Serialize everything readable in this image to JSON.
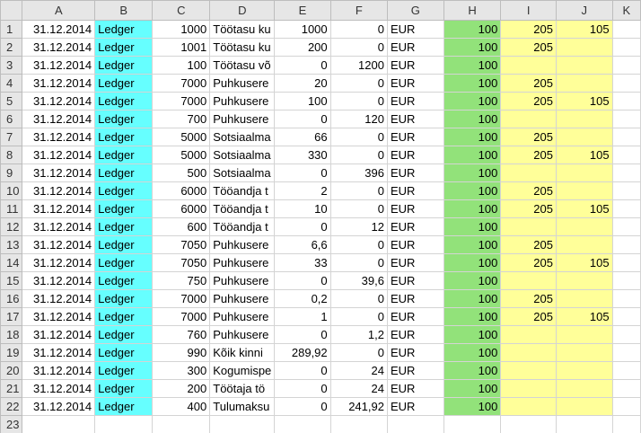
{
  "columns": [
    "A",
    "B",
    "C",
    "D",
    "E",
    "F",
    "G",
    "H",
    "I",
    "J",
    "K"
  ],
  "rows": [
    {
      "n": "1",
      "a": "31.12.2014",
      "b": "Ledger",
      "c": "1000",
      "d": "Töötasu ku",
      "e": "1000",
      "f": "0",
      "g": "EUR",
      "h": "100",
      "i": "205",
      "j": "105"
    },
    {
      "n": "2",
      "a": "31.12.2014",
      "b": "Ledger",
      "c": "1001",
      "d": "Töötasu ku",
      "e": "200",
      "f": "0",
      "g": "EUR",
      "h": "100",
      "i": "205",
      "j": ""
    },
    {
      "n": "3",
      "a": "31.12.2014",
      "b": "Ledger",
      "c": "100",
      "d": "Töötasu võ",
      "e": "0",
      "f": "1200",
      "g": "EUR",
      "h": "100",
      "i": "",
      "j": ""
    },
    {
      "n": "4",
      "a": "31.12.2014",
      "b": "Ledger",
      "c": "7000",
      "d": "Puhkusere",
      "e": "20",
      "f": "0",
      "g": "EUR",
      "h": "100",
      "i": "205",
      "j": ""
    },
    {
      "n": "5",
      "a": "31.12.2014",
      "b": "Ledger",
      "c": "7000",
      "d": "Puhkusere",
      "e": "100",
      "f": "0",
      "g": "EUR",
      "h": "100",
      "i": "205",
      "j": "105"
    },
    {
      "n": "6",
      "a": "31.12.2014",
      "b": "Ledger",
      "c": "700",
      "d": "Puhkusere",
      "e": "0",
      "f": "120",
      "g": "EUR",
      "h": "100",
      "i": "",
      "j": ""
    },
    {
      "n": "7",
      "a": "31.12.2014",
      "b": "Ledger",
      "c": "5000",
      "d": "Sotsiaalma",
      "e": "66",
      "f": "0",
      "g": "EUR",
      "h": "100",
      "i": "205",
      "j": ""
    },
    {
      "n": "8",
      "a": "31.12.2014",
      "b": "Ledger",
      "c": "5000",
      "d": "Sotsiaalma",
      "e": "330",
      "f": "0",
      "g": "EUR",
      "h": "100",
      "i": "205",
      "j": "105"
    },
    {
      "n": "9",
      "a": "31.12.2014",
      "b": "Ledger",
      "c": "500",
      "d": "Sotsiaalma",
      "e": "0",
      "f": "396",
      "g": "EUR",
      "h": "100",
      "i": "",
      "j": ""
    },
    {
      "n": "10",
      "a": "31.12.2014",
      "b": "Ledger",
      "c": "6000",
      "d": "Tööandja t",
      "e": "2",
      "f": "0",
      "g": "EUR",
      "h": "100",
      "i": "205",
      "j": ""
    },
    {
      "n": "11",
      "a": "31.12.2014",
      "b": "Ledger",
      "c": "6000",
      "d": "Tööandja t",
      "e": "10",
      "f": "0",
      "g": "EUR",
      "h": "100",
      "i": "205",
      "j": "105"
    },
    {
      "n": "12",
      "a": "31.12.2014",
      "b": "Ledger",
      "c": "600",
      "d": "Tööandja t",
      "e": "0",
      "f": "12",
      "g": "EUR",
      "h": "100",
      "i": "",
      "j": ""
    },
    {
      "n": "13",
      "a": "31.12.2014",
      "b": "Ledger",
      "c": "7050",
      "d": "Puhkusere",
      "e": "6,6",
      "f": "0",
      "g": "EUR",
      "h": "100",
      "i": "205",
      "j": ""
    },
    {
      "n": "14",
      "a": "31.12.2014",
      "b": "Ledger",
      "c": "7050",
      "d": "Puhkusere",
      "e": "33",
      "f": "0",
      "g": "EUR",
      "h": "100",
      "i": "205",
      "j": "105"
    },
    {
      "n": "15",
      "a": "31.12.2014",
      "b": "Ledger",
      "c": "750",
      "d": "Puhkusere",
      "e": "0",
      "f": "39,6",
      "g": "EUR",
      "h": "100",
      "i": "",
      "j": ""
    },
    {
      "n": "16",
      "a": "31.12.2014",
      "b": "Ledger",
      "c": "7000",
      "d": "Puhkusere",
      "e": "0,2",
      "f": "0",
      "g": "EUR",
      "h": "100",
      "i": "205",
      "j": ""
    },
    {
      "n": "17",
      "a": "31.12.2014",
      "b": "Ledger",
      "c": "7000",
      "d": "Puhkusere",
      "e": "1",
      "f": "0",
      "g": "EUR",
      "h": "100",
      "i": "205",
      "j": "105"
    },
    {
      "n": "18",
      "a": "31.12.2014",
      "b": "Ledger",
      "c": "760",
      "d": "Puhkusere",
      "e": "0",
      "f": "1,2",
      "g": "EUR",
      "h": "100",
      "i": "",
      "j": ""
    },
    {
      "n": "19",
      "a": "31.12.2014",
      "b": "Ledger",
      "c": "990",
      "d": "Kõik kinni",
      "e": "289,92",
      "f": "0",
      "g": "EUR",
      "h": "100",
      "i": "",
      "j": ""
    },
    {
      "n": "20",
      "a": "31.12.2014",
      "b": "Ledger",
      "c": "300",
      "d": "Kogumispe",
      "e": "0",
      "f": "24",
      "g": "EUR",
      "h": "100",
      "i": "",
      "j": ""
    },
    {
      "n": "21",
      "a": "31.12.2014",
      "b": "Ledger",
      "c": "200",
      "d": "Töötaja tö",
      "e": "0",
      "f": "24",
      "g": "EUR",
      "h": "100",
      "i": "",
      "j": ""
    },
    {
      "n": "22",
      "a": "31.12.2014",
      "b": "Ledger",
      "c": "400",
      "d": "Tulumaksu",
      "e": "0",
      "f": "241,92",
      "g": "EUR",
      "h": "100",
      "i": "",
      "j": ""
    },
    {
      "n": "23",
      "a": "",
      "b": "",
      "c": "",
      "d": "",
      "e": "",
      "f": "",
      "g": "",
      "h": "",
      "i": "",
      "j": ""
    }
  ],
  "colors": {
    "column_b_fill": "#66ffff",
    "column_h_fill": "#92e27a",
    "columns_ij_fill": "#ffff99",
    "header_fill": "#e6e6e6",
    "gridline": "#d4d4d4"
  }
}
